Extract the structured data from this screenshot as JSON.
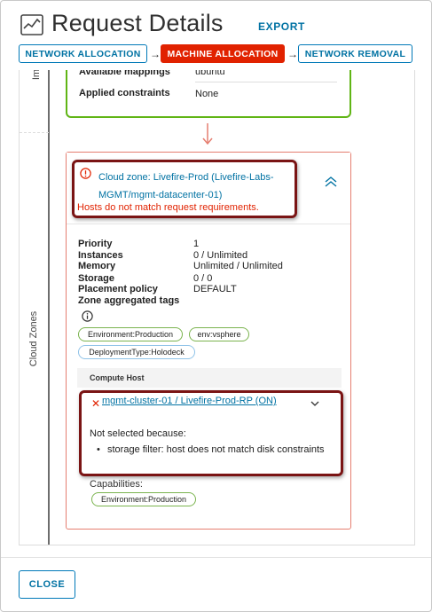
{
  "header": {
    "title": "Request Details",
    "export_label": "EXPORT"
  },
  "stepper": {
    "steps": [
      {
        "label": "NETWORK ALLOCATION",
        "active": false
      },
      {
        "label": "MACHINE ALLOCATION",
        "active": true
      },
      {
        "label": "NETWORK REMOVAL",
        "active": false
      }
    ]
  },
  "image_section": {
    "vertical_label": "Ima",
    "rows": [
      {
        "label": "Available mappings",
        "value": "ubuntu"
      },
      {
        "label": "Applied constraints",
        "value": "None"
      }
    ]
  },
  "cloud_zones": {
    "vertical_label": "Cloud Zones",
    "zone_title": "Cloud zone: Livefire-Prod (Livefire-Labs-MGMT/mgmt-datacenter-01)",
    "error_message": "Hosts do not match request requirements.",
    "properties": [
      {
        "label": "Priority",
        "value": "1"
      },
      {
        "label": "Instances",
        "value": "0 / Unlimited"
      },
      {
        "label": "Memory",
        "value": "Unlimited / Unlimited"
      },
      {
        "label": "Storage",
        "value": "0 / 0"
      },
      {
        "label": "Placement policy",
        "value": "DEFAULT"
      }
    ],
    "zone_tags_label": "Zone aggregated tags",
    "tags": [
      "Environment:Production",
      "env:vsphere",
      "DeploymentType:Holodeck"
    ],
    "compute_host_header": "Compute Host",
    "host": {
      "name": "mgmt-cluster-01 / Livefire-Prod-RP (ON)",
      "not_selected_label": "Not selected because:",
      "reason": "storage filter: host does not match disk constraints"
    },
    "capabilities_label": "Capabilities:",
    "capabilities": [
      "Environment:Production"
    ]
  },
  "footer": {
    "close_label": "CLOSE"
  },
  "colors": {
    "accent": "#0072a3",
    "active_step": "#e12200",
    "success_border": "#60b515",
    "error": "#e12200",
    "highlight_box": "#7a1414"
  }
}
